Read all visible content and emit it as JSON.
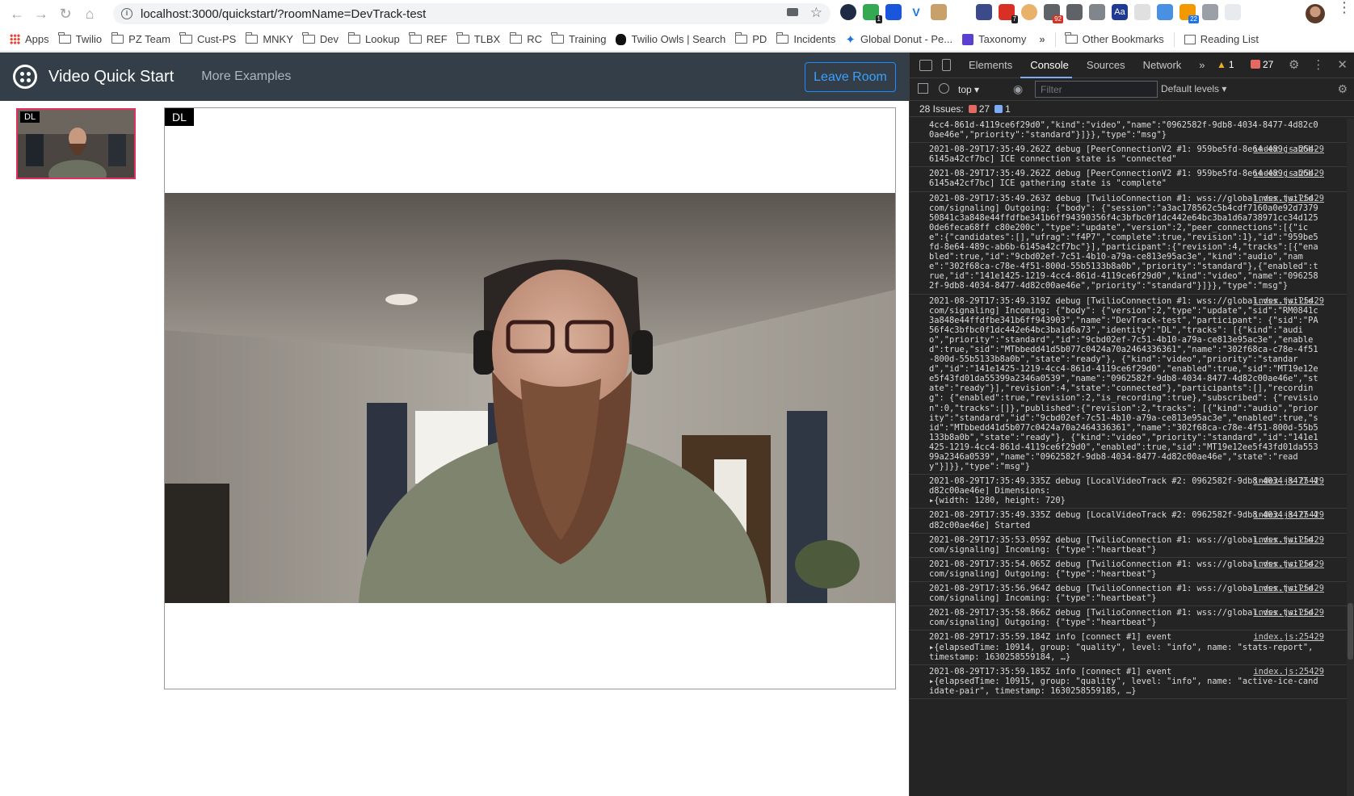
{
  "browser": {
    "url": "localhost:3000/quickstart/?roomName=DevTrack-test",
    "bookmarks": [
      {
        "label": "Apps",
        "icon": "apps-grid-icon"
      },
      {
        "label": "Twilio",
        "icon": "folder-icon"
      },
      {
        "label": "PZ Team",
        "icon": "folder-icon"
      },
      {
        "label": "Cust-PS",
        "icon": "folder-icon"
      },
      {
        "label": "MNKY",
        "icon": "folder-icon"
      },
      {
        "label": "Dev",
        "icon": "folder-icon"
      },
      {
        "label": "Lookup",
        "icon": "folder-icon"
      },
      {
        "label": "REF",
        "icon": "folder-icon"
      },
      {
        "label": "TLBX",
        "icon": "folder-icon"
      },
      {
        "label": "RC",
        "icon": "folder-icon"
      },
      {
        "label": "Training",
        "icon": "folder-icon"
      },
      {
        "label": "Twilio Owls | Search",
        "icon": "owl-icon"
      },
      {
        "label": "PD",
        "icon": "folder-icon"
      },
      {
        "label": "Incidents",
        "icon": "folder-icon"
      },
      {
        "label": "Global Donut - Pe...",
        "icon": "donut-icon"
      },
      {
        "label": "Taxonomy",
        "icon": "taxonomy-icon"
      }
    ],
    "more": "»",
    "other_bookmarks": "Other Bookmarks",
    "reading_list": "Reading List",
    "extension_badges": [
      "1",
      "7",
      "92",
      "22"
    ]
  },
  "app": {
    "title": "Video Quick Start",
    "more_examples": "More Examples",
    "leave_button": "Leave Room",
    "thumbnail_label": "DL",
    "main_label": "DL"
  },
  "devtools": {
    "tabs": [
      "Elements",
      "Console",
      "Sources",
      "Network"
    ],
    "more_tabs": "»",
    "active_tab": "Console",
    "warnings": "1",
    "errors": "27",
    "context": "top ▾",
    "filter_placeholder": "Filter",
    "levels": "Default levels ▾",
    "issues_label": "28 Issues:",
    "issues_errors": "27",
    "issues_info": "1",
    "logs": [
      {
        "text": "4cc4-861d-4119ce6f29d0\",\"kind\":\"video\",\"name\":\"0962582f-9db8-4034-8477-4d82c00ae46e\",\"priority\":\"standard\"}]}},\"type\":\"msg\"}",
        "src": ""
      },
      {
        "text": "2021-08-29T17:35:49.262Z debug [PeerConnectionV2 #1: 959be5fd-8e64-489c-ab6b-6145a42cf7bc] ICE connection state is \"connected\"",
        "src": "index.js:25429"
      },
      {
        "text": "2021-08-29T17:35:49.262Z debug [PeerConnectionV2 #1: 959be5fd-8e64-489c-ab6b-6145a42cf7bc] ICE gathering state is \"complete\"",
        "src": "index.js:25429"
      },
      {
        "text": "2021-08-29T17:35:49.263Z debug [TwilioConnection #1: wss://global.vss.twilio.com/signaling] Outgoing: {\"body\": {\"session\":\"a3ac178562c5b4cdf7160a0e92d737950841c3a848e44ffdfbe341b6ff94390356f4c3bfbc0f1dc442e64bc3ba1d6a738971cc34d1250de6feca68ff c80e200c\",\"type\":\"update\",\"version\":2,\"peer_connections\":[{\"ice\":{\"candidates\":[],\"ufrag\":\"f4P7\",\"complete\":true,\"revision\":1},\"id\":\"959be5fd-8e64-489c-ab6b-6145a42cf7bc\"}],\"participant\":{\"revision\":4,\"tracks\":[{\"enabled\":true,\"id\":\"9cbd02ef-7c51-4b10-a79a-ce813e95ac3e\",\"kind\":\"audio\",\"name\":\"302f68ca-c78e-4f51-800d-55b5133b8a0b\",\"priority\":\"standard\"},{\"enabled\":true,\"id\":\"141e1425-1219-4cc4-861d-4119ce6f29d0\",\"kind\":\"video\",\"name\":\"0962582f-9db8-4034-8477-4d82c00ae46e\",\"priority\":\"standard\"}]}},\"type\":\"msg\"}",
        "src": "index.js:25429"
      },
      {
        "text": "2021-08-29T17:35:49.319Z debug [TwilioConnection #1: wss://global.vss.twilio.com/signaling] Incoming: {\"body\": {\"version\":2,\"type\":\"update\",\"sid\":\"RM0841c3a848e44ffdfbe341b6ff943903\",\"name\":\"DevTrack-test\",\"participant\": {\"sid\":\"PA56f4c3bfbc0f1dc442e64bc3ba1d6a73\",\"identity\":\"DL\",\"tracks\": [{\"kind\":\"audio\",\"priority\":\"standard\",\"id\":\"9cbd02ef-7c51-4b10-a79a-ce813e95ac3e\",\"enabled\":true,\"sid\":\"MTbbedd41d5b077c0424a70a2464336361\",\"name\":\"302f68ca-c78e-4f51-800d-55b5133b8a0b\",\"state\":\"ready\"}, {\"kind\":\"video\",\"priority\":\"standard\",\"id\":\"141e1425-1219-4cc4-861d-4119ce6f29d0\",\"enabled\":true,\"sid\":\"MT19e12ee5f43fd01da55399a2346a0539\",\"name\":\"0962582f-9db8-4034-8477-4d82c00ae46e\",\"state\":\"ready\"}],\"revision\":4,\"state\":\"connected\"},\"participants\":[],\"recording\": {\"enabled\":true,\"revision\":2,\"is_recording\":true},\"subscribed\": {\"revision\":0,\"tracks\":[]},\"published\":{\"revision\":2,\"tracks\": [{\"kind\":\"audio\",\"priority\":\"standard\",\"id\":\"9cbd02ef-7c51-4b10-a79a-ce813e95ac3e\",\"enabled\":true,\"sid\":\"MTbbedd41d5b077c0424a70a2464336361\",\"name\":\"302f68ca-c78e-4f51-800d-55b5133b8a0b\",\"state\":\"ready\"}, {\"kind\":\"video\",\"priority\":\"standard\",\"id\":\"141e1425-1219-4cc4-861d-4119ce6f29d0\",\"enabled\":true,\"sid\":\"MT19e12ee5f43fd01da55399a2346a0539\",\"name\":\"0962582f-9db8-4034-8477-4d82c00ae46e\",\"state\":\"ready\"}]}},\"type\":\"msg\"}",
        "src": "index.js:25429"
      },
      {
        "text": "2021-08-29T17:35:49.335Z debug [LocalVideoTrack #2: 0962582f-9db8-4034-8477-4d82c00ae46e] Dimensions:\n▸{width: 1280, height: 720}",
        "src": "index.js:25429"
      },
      {
        "text": "2021-08-29T17:35:49.335Z debug [LocalVideoTrack #2: 0962582f-9db8-4034-8477-4d82c00ae46e] Started",
        "src": "index.js:25429"
      },
      {
        "text": "2021-08-29T17:35:53.059Z debug [TwilioConnection #1: wss://global.vss.twilio.com/signaling] Incoming: {\"type\":\"heartbeat\"}",
        "src": "index.js:25429"
      },
      {
        "text": "2021-08-29T17:35:54.065Z debug [TwilioConnection #1: wss://global.vss.twilio.com/signaling] Outgoing: {\"type\":\"heartbeat\"}",
        "src": "index.js:25429"
      },
      {
        "text": "2021-08-29T17:35:56.964Z debug [TwilioConnection #1: wss://global.vss.twilio.com/signaling] Incoming: {\"type\":\"heartbeat\"}",
        "src": "index.js:25429"
      },
      {
        "text": "2021-08-29T17:35:58.866Z debug [TwilioConnection #1: wss://global.vss.twilio.com/signaling] Outgoing: {\"type\":\"heartbeat\"}",
        "src": "index.js:25429"
      },
      {
        "text": "2021-08-29T17:35:59.184Z info [connect #1] event\n▸{elapsedTime: 10914, group: \"quality\", level: \"info\", name: \"stats-report\", timestamp: 1630258559184, …}",
        "src": "index.js:25429"
      },
      {
        "text": "2021-08-29T17:35:59.185Z info [connect #1] event\n▸{elapsedTime: 10915, group: \"quality\", level: \"info\", name: \"active-ice-candidate-pair\", timestamp: 1630258559185, …}",
        "src": "index.js:25429"
      }
    ]
  }
}
